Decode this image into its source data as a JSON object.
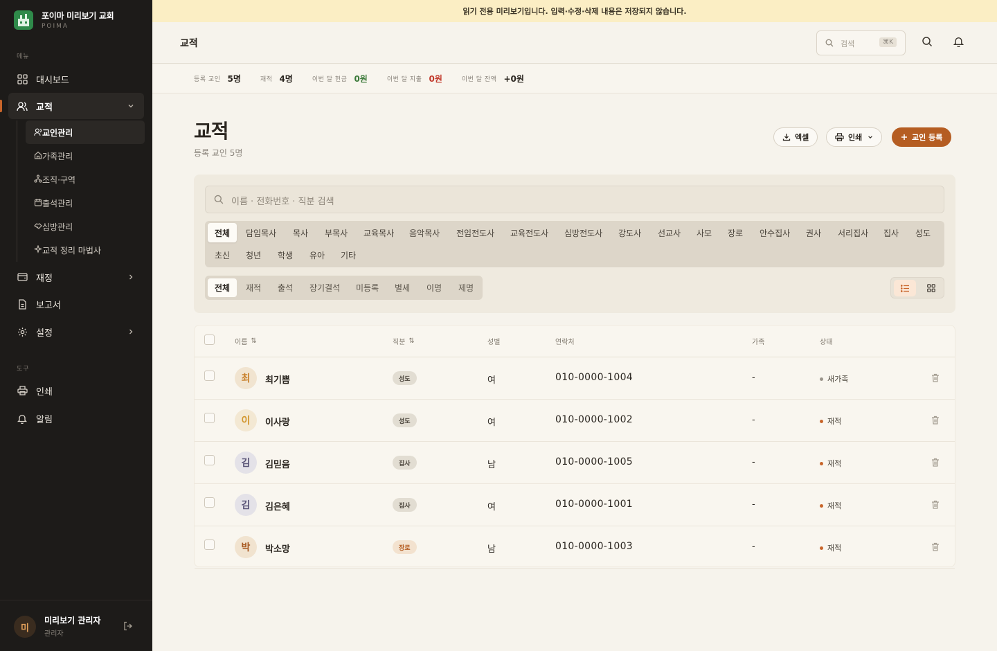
{
  "brand": {
    "name": "포이마 미리보기 교회",
    "sub": "POIMA"
  },
  "sidebar": {
    "menu_label": "메뉴",
    "tools_label": "도구",
    "items": [
      {
        "label": "대시보드",
        "icon": "dashboard-icon"
      },
      {
        "label": "교적",
        "icon": "users-icon",
        "active": true
      },
      {
        "label": "재정",
        "icon": "wallet-icon"
      },
      {
        "label": "보고서",
        "icon": "report-icon"
      },
      {
        "label": "설정",
        "icon": "gear-icon"
      }
    ],
    "sub_items": [
      {
        "label": "교인관리",
        "active": true
      },
      {
        "label": "가족관리"
      },
      {
        "label": "조직·구역"
      },
      {
        "label": "출석관리"
      },
      {
        "label": "심방관리"
      },
      {
        "label": "교적 정리 마법사"
      }
    ],
    "tools": [
      {
        "label": "인쇄"
      },
      {
        "label": "알림"
      }
    ],
    "user": {
      "initial": "미",
      "name": "미리보기 관리자",
      "role": "관리자"
    }
  },
  "banner": "읽기 전용 미리보기입니다. 입력·수정·삭제 내용은 저장되지 않습니다.",
  "topbar": {
    "title": "교적",
    "search_placeholder": "검색",
    "shortcut": "⌘K"
  },
  "stats": [
    {
      "label": "등록 교인",
      "value": "5명",
      "tone": "plain"
    },
    {
      "label": "재적",
      "value": "4명",
      "tone": "plain"
    },
    {
      "label": "이번 달 헌금",
      "value": "0원",
      "tone": "green"
    },
    {
      "label": "이번 달 지출",
      "value": "0원",
      "tone": "red"
    },
    {
      "label": "이번 달 잔액",
      "value": "+0원",
      "tone": "plain"
    }
  ],
  "page": {
    "title": "교적",
    "subtitle": "등록 교인 5명"
  },
  "actions": {
    "excel": "엑셀",
    "print": "인쇄",
    "add": "교인 등록"
  },
  "filters": {
    "search_placeholder": "이름 · 전화번호 · 직분 검색",
    "roles_row1": [
      "전체",
      "담임목사",
      "목사",
      "부목사",
      "교육목사",
      "음악목사",
      "전임전도사",
      "교육전도사",
      "심방전도사",
      "강도사",
      "선교사",
      "사모",
      "장로",
      "안수집사",
      "권사",
      "서리집사",
      "집사",
      "성도"
    ],
    "roles_row2": [
      "초신",
      "청년",
      "학생",
      "유아",
      "기타"
    ],
    "status_tabs": [
      "전체",
      "재적",
      "출석",
      "장기결석",
      "미등록",
      "별세",
      "이명",
      "제명"
    ]
  },
  "table": {
    "headers": {
      "name": "이름",
      "role": "직분",
      "gender": "성별",
      "phone": "연락처",
      "family": "가족",
      "status": "상태"
    },
    "rows": [
      {
        "initial": "최",
        "name": "최기쁨",
        "role": "성도",
        "gender": "여",
        "phone": "010-0000-1004",
        "family": "-",
        "status": "새가족",
        "status_color": "#9a948a",
        "avatar_bg": "#f1e4d0",
        "avatar_fg": "#c9822e",
        "badge": "plain"
      },
      {
        "initial": "이",
        "name": "이사랑",
        "role": "성도",
        "gender": "여",
        "phone": "010-0000-1002",
        "family": "-",
        "status": "재적",
        "status_color": "#c8652a",
        "avatar_bg": "#f3e8d3",
        "avatar_fg": "#d2962e",
        "badge": "plain"
      },
      {
        "initial": "김",
        "name": "김믿음",
        "role": "집사",
        "gender": "남",
        "phone": "010-0000-1005",
        "family": "-",
        "status": "재적",
        "status_color": "#c8652a",
        "avatar_bg": "#e4e2e8",
        "avatar_fg": "#5b5578",
        "badge": "plain"
      },
      {
        "initial": "김",
        "name": "김은혜",
        "role": "집사",
        "gender": "여",
        "phone": "010-0000-1001",
        "family": "-",
        "status": "재적",
        "status_color": "#c8652a",
        "avatar_bg": "#e4e2e8",
        "avatar_fg": "#5b5578",
        "badge": "plain"
      },
      {
        "initial": "박",
        "name": "박소망",
        "role": "장로",
        "gender": "남",
        "phone": "010-0000-1003",
        "family": "-",
        "status": "재적",
        "status_color": "#c8652a",
        "avatar_bg": "#f1e3cf",
        "avatar_fg": "#a85a22",
        "badge": "warm"
      }
    ]
  }
}
